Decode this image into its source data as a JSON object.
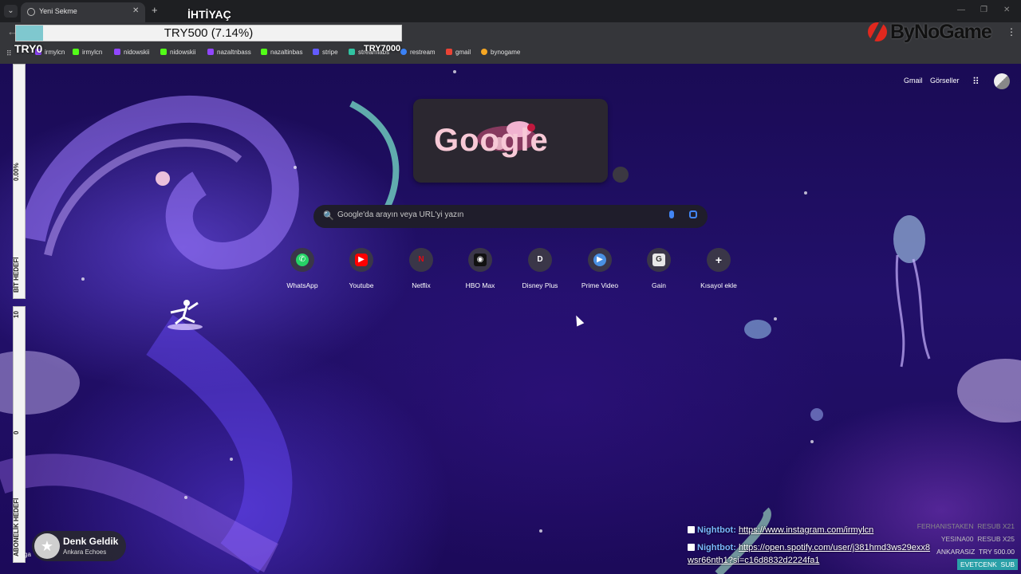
{
  "browser": {
    "tab_title": "Yeni Sekme",
    "tab_close": "✕",
    "new_tab": "+",
    "tab_menu": "⌄",
    "win_minimize": "—",
    "win_maximize": "❐",
    "win_close": "✕",
    "back": "←",
    "menu": "⋮",
    "apps_grid": "⠿"
  },
  "bookmarks": [
    {
      "label": "irmylcn",
      "icon": "twitch-icon",
      "color": "#9146ff"
    },
    {
      "label": "irmylcn",
      "icon": "kick-icon",
      "color": "#53fc18"
    },
    {
      "label": "nidowskii",
      "icon": "twitch-icon",
      "color": "#9146ff"
    },
    {
      "label": "nidowskii",
      "icon": "kick-icon",
      "color": "#53fc18"
    },
    {
      "label": "nazaltnbass",
      "icon": "twitch-icon",
      "color": "#9146ff"
    },
    {
      "label": "nazaltinbas",
      "icon": "kick-icon",
      "color": "#53fc18"
    },
    {
      "label": "stripe",
      "icon": "stripe-icon",
      "color": "#635bff"
    },
    {
      "label": "streamlabs",
      "icon": "streamlabs-icon",
      "color": "#31c3a2"
    },
    {
      "label": "restream",
      "icon": "restream-icon",
      "color": "#3b82f6"
    },
    {
      "label": "gmail",
      "icon": "gmail-icon",
      "color": "#ea4335"
    },
    {
      "label": "bynogame",
      "icon": "bynogame-icon",
      "color": "#f5a623"
    }
  ],
  "overlay": {
    "goal_title": "İHTİYAÇ",
    "goal_text": "TRY500 (7.14%)",
    "goal_fraction": 0.0714,
    "goal_start": "TRY0",
    "goal_end": "TRY7000",
    "brand": "ByNoGame",
    "bit_goal_label": "BİT HEDEFİ",
    "bit_goal_percent": "0.00%",
    "sub_goal_label": "ABONELİK HEDEFİ",
    "sub_goal_max": "10",
    "sub_goal_min": "0"
  },
  "ntp": {
    "gmail": "Gmail",
    "images": "Görseller",
    "apps": "⠿",
    "doodle": "Google",
    "search_placeholder": "Google'da arayın veya URL'yi yazın",
    "search_icon": "🔍",
    "shortcuts": [
      {
        "label": "WhatsApp",
        "icon": "whatsapp-icon",
        "glyph": "✆",
        "color": "#25d366"
      },
      {
        "label": "Youtube",
        "icon": "youtube-icon",
        "glyph": "▶",
        "color": "#ff0000"
      },
      {
        "label": "Netflix",
        "icon": "netflix-icon",
        "glyph": "N",
        "color": "#e50914"
      },
      {
        "label": "HBO Max",
        "icon": "hbomax-icon",
        "glyph": "◉",
        "color": "#111111"
      },
      {
        "label": "Disney Plus",
        "icon": "disneyplus-icon",
        "glyph": "D",
        "color": "#3a3648"
      },
      {
        "label": "Prime Video",
        "icon": "primevideo-icon",
        "glyph": "▶",
        "color": "#4a90e2"
      },
      {
        "label": "Gain",
        "icon": "gain-icon",
        "glyph": "G",
        "color": "#e8e8e8"
      },
      {
        "label": "Kısayol ekle",
        "icon": "plus-icon",
        "glyph": "+",
        "color": "#3a3648"
      }
    ]
  },
  "now_playing": {
    "title": "Denk Geldik",
    "artist": "Ankara Echoes",
    "fragment": "ga"
  },
  "chat": [
    {
      "user": "Nightbot:",
      "message": "https://www.instagram.com/irmylcn"
    },
    {
      "user": "Nightbot:",
      "message": "https://open.spotify.com/user/j381hmd3ws29exx8",
      "cont": "wsr66nth1?si=c16d8832d2224fa1"
    }
  ],
  "events": [
    {
      "name": "FERHANISTAKEN",
      "detail": "RESUB X21"
    },
    {
      "name": "YESINA00",
      "detail": "RESUB X25"
    },
    {
      "name": "ANKARASIZ",
      "detail": "TRY 500.00"
    },
    {
      "name": "EVETCENK",
      "detail": "SUB"
    }
  ]
}
